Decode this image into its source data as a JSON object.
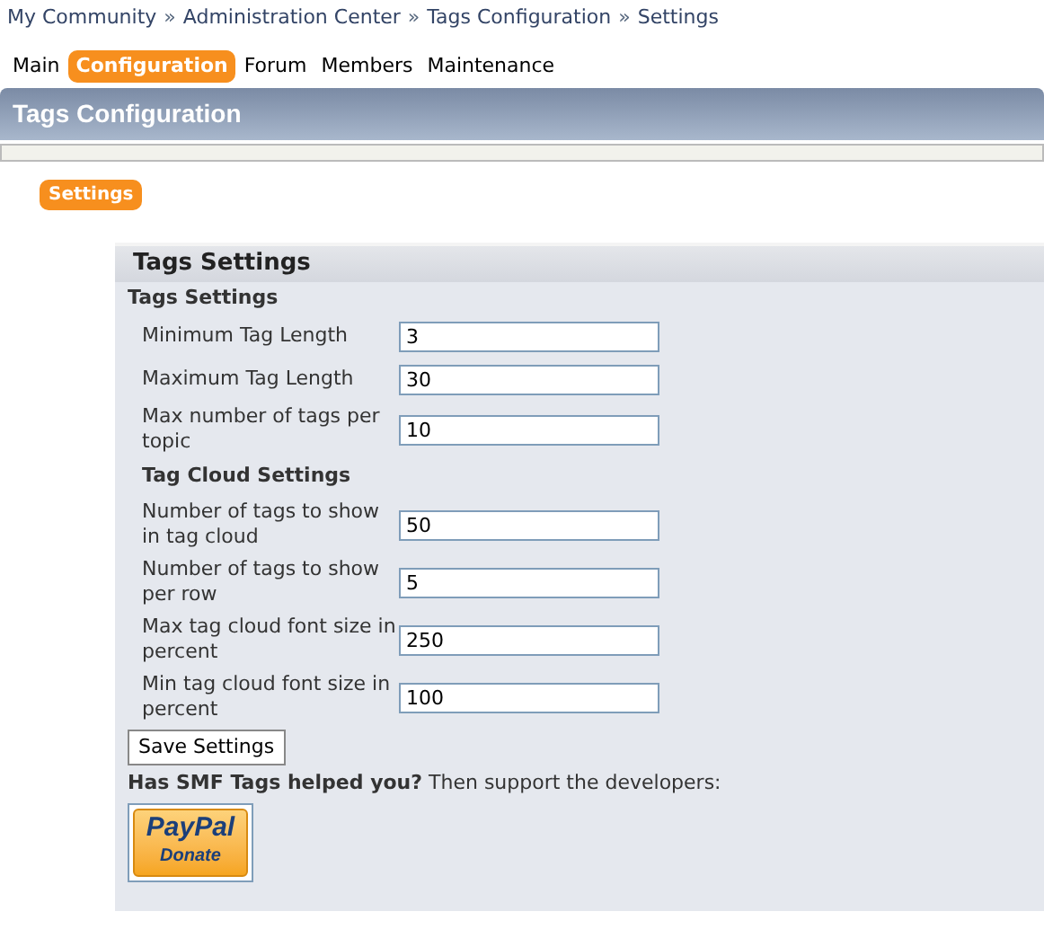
{
  "breadcrumb": [
    "My Community",
    "Administration Center",
    "Tags Configuration",
    "Settings"
  ],
  "breadcrumb_separator": "»",
  "menu": [
    {
      "label": "Main",
      "selected": false
    },
    {
      "label": "Configuration",
      "selected": true
    },
    {
      "label": "Forum",
      "selected": false
    },
    {
      "label": "Members",
      "selected": false
    },
    {
      "label": "Maintenance",
      "selected": false
    }
  ],
  "page_title": "Tags Configuration",
  "subtabs": [
    {
      "label": "Settings",
      "selected": true
    }
  ],
  "panel": {
    "title": "Tags Settings",
    "rows": [
      {
        "kind": "heading",
        "text": "Tags Settings"
      },
      {
        "kind": "field",
        "label": "Minimum Tag Length",
        "value": "3"
      },
      {
        "kind": "field",
        "label": "Maximum Tag Length",
        "value": "30"
      },
      {
        "kind": "field",
        "label": "Max number of tags per topic",
        "value": "10"
      },
      {
        "kind": "subheading",
        "text": "Tag Cloud Settings"
      },
      {
        "kind": "field",
        "label": "Number of tags to show in tag cloud",
        "value": "50"
      },
      {
        "kind": "field",
        "label": "Number of tags to show per row",
        "value": "5"
      },
      {
        "kind": "field",
        "label": "Max tag cloud font size in percent",
        "value": "250"
      },
      {
        "kind": "field",
        "label": "Min tag cloud font size in percent",
        "value": "100"
      }
    ],
    "save_button": "Save Settings",
    "donate_text": "**Has SMF Tags helped you?** Then support the developers:",
    "donate_button": {
      "brand": "PayPal",
      "label": "Donate"
    }
  }
}
